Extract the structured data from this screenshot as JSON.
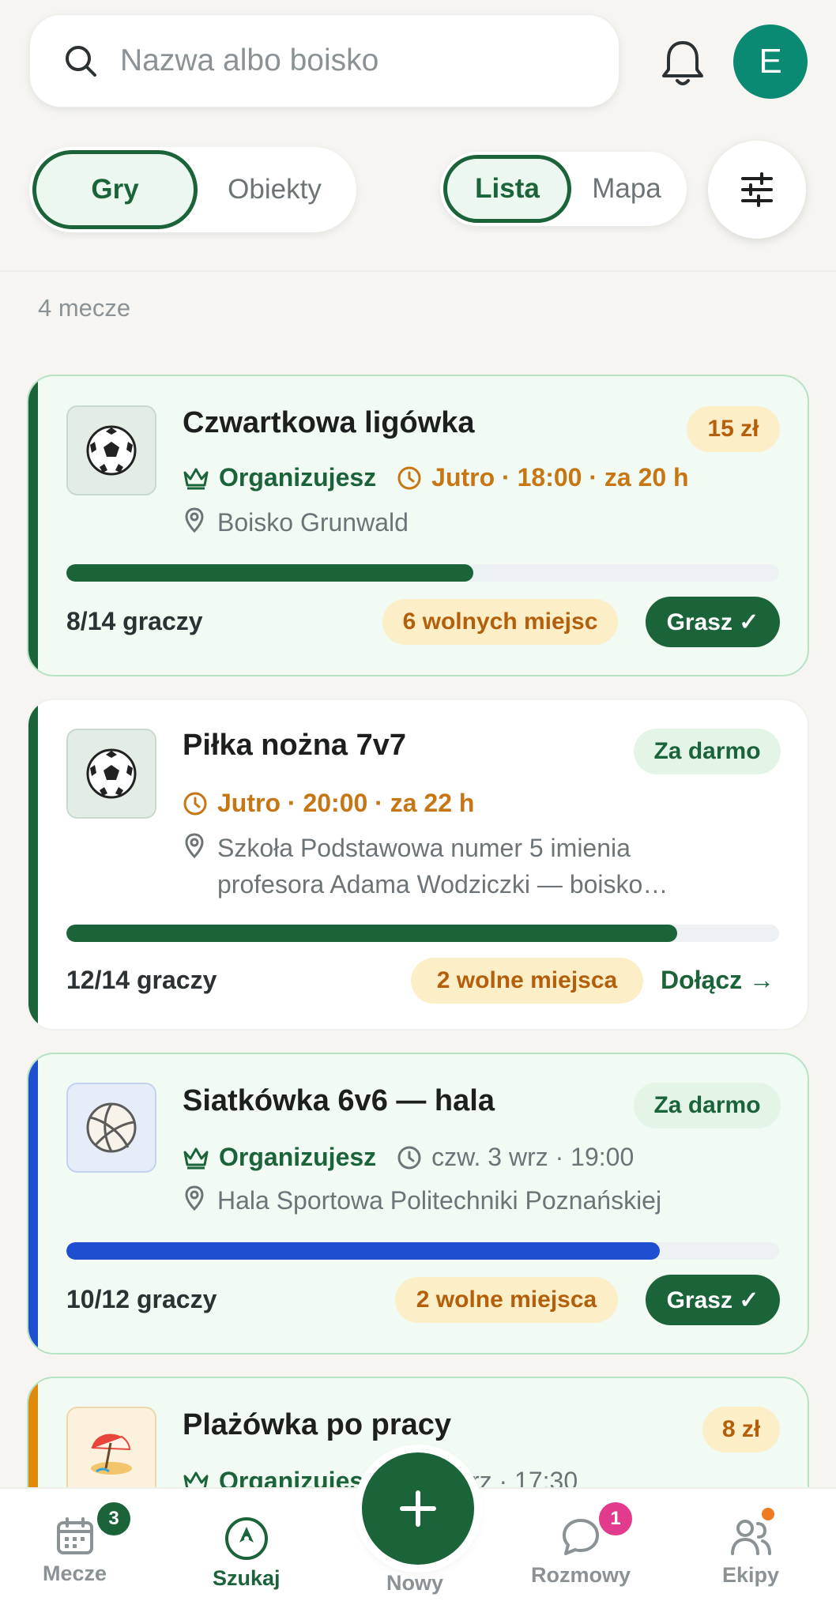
{
  "header": {
    "search_placeholder": "Nazwa albo boisko",
    "avatar_initial": "E"
  },
  "segments": {
    "mode": [
      "Gry",
      "Obiekty"
    ],
    "mode_selected": "Gry",
    "view": [
      "Lista",
      "Mapa"
    ],
    "view_selected": "Lista"
  },
  "results_count": "4 mecze",
  "games": [
    {
      "icon": "soccer-ball-icon",
      "title": "Czwartkowa ligówka",
      "price": "15 zł",
      "organizer_label": "Organizujesz",
      "when": "Jutro · 18:00 · za 20 h",
      "location": "Boisko Grunwald",
      "players": "8/14 graczy",
      "fill_fraction": 0.571,
      "slots": "6 wolnych miejsc",
      "action": "Grasz ✓",
      "accent": "#1b6338"
    },
    {
      "icon": "soccer-ball-icon",
      "title": "Piłka nożna 7v7",
      "price": "Za darmo",
      "when": "Jutro · 20:00 · za 22 h",
      "location_line1": "Szkoła Podstawowa numer 5 imienia",
      "location_line2": "profesora Adama Wodziczki — boisko…",
      "players": "12/14 graczy",
      "fill_fraction": 0.857,
      "slots": "2 wolne miejsca",
      "action": "Dołącz →",
      "accent": "#1b6338"
    },
    {
      "icon": "volleyball-icon",
      "title": "Siatkówka 6v6 — hala",
      "price": "Za darmo",
      "organizer_label": "Organizujesz",
      "when": "czw. 3 wrz · 19:00",
      "location": "Hala Sportowa Politechniki Poznańskiej",
      "players": "10/12 graczy",
      "fill_fraction": 0.833,
      "slots": "2 wolne miejsca",
      "action": "Grasz ✓",
      "accent": "#1f4fd1"
    },
    {
      "icon": "beach-umbrella-icon",
      "title": "Plażówka po pracy",
      "price": "8 zł",
      "organizer_label": "Organizujesz",
      "when": "5 wrz · 17:30",
      "accent": "#e08a0c"
    }
  ],
  "bottom_nav": {
    "items": [
      "Mecze",
      "Szukaj",
      "Nowy",
      "Rozmowy",
      "Ekipy"
    ],
    "active": "Szukaj",
    "mecze_badge": "3",
    "rozmowy_badge": "1"
  },
  "colors": {
    "brand_green": "#1b6338",
    "orange": "#c77614",
    "blue": "#1f4fd1"
  }
}
